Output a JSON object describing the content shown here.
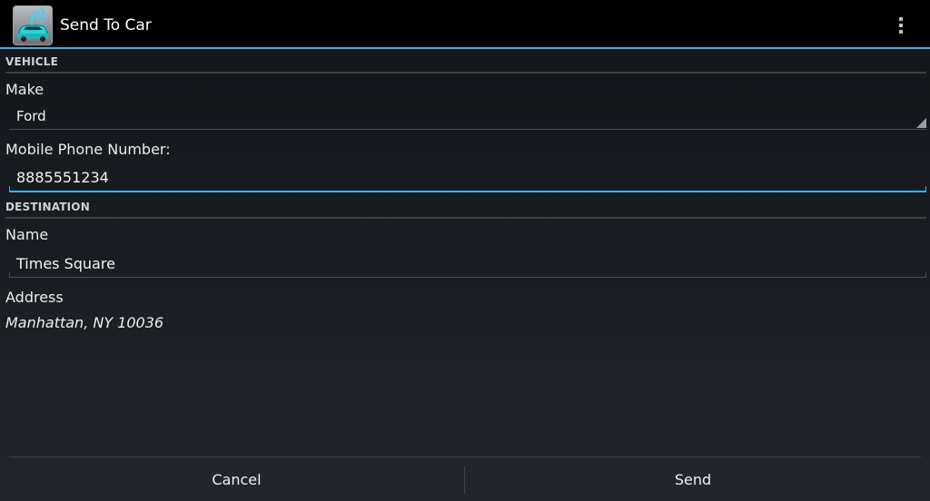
{
  "app": {
    "title": "Send To Car",
    "icon": "car-signal-icon",
    "accent_color": "#33b5e5"
  },
  "vehicle": {
    "section_title": "VEHICLE",
    "make_label": "Make",
    "make_value": "Ford",
    "phone_label": "Mobile Phone Number:",
    "phone_value": "8885551234"
  },
  "destination": {
    "section_title": "DESTINATION",
    "name_label": "Name",
    "name_value": "Times Square",
    "address_label": "Address",
    "address_value": "Manhattan, NY 10036"
  },
  "buttons": {
    "cancel_label": "Cancel",
    "send_label": "Send"
  }
}
